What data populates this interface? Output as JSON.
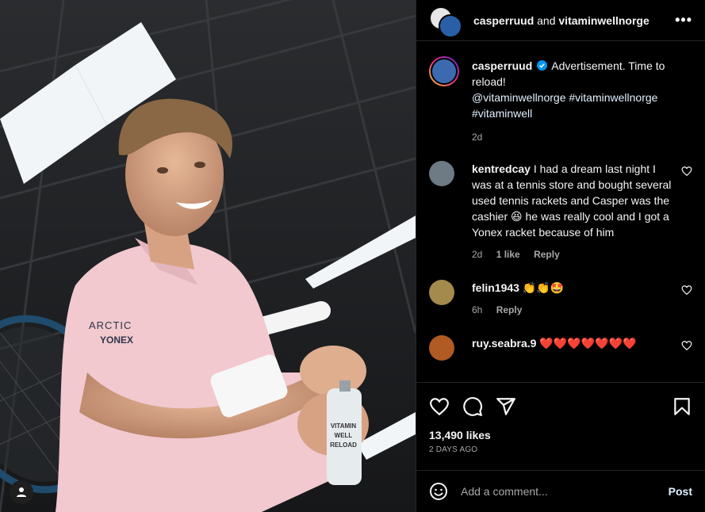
{
  "header": {
    "user1": "casperruud",
    "connector": "and",
    "user2": "vitaminwellnorge"
  },
  "caption": {
    "username": "casperruud",
    "text": "Advertisement. Time to reload!",
    "mention": "@vitaminwellnorge",
    "tags": "#vitaminwellnorge #vitaminwell",
    "age": "2d"
  },
  "comments": [
    {
      "username": "kentredcay",
      "text": "I had a dream last night I was at a tennis store and bought several used tennis rackets and Casper was the cashier 😆 he was really cool and I got a Yonex racket because of him",
      "age": "2d",
      "likes": "1 like",
      "reply": "Reply"
    },
    {
      "username": "felin1943",
      "text": "👏👏🤩",
      "age": "6h",
      "reply": "Reply"
    },
    {
      "username": "ruy.seabra.9",
      "text": "❤️❤️❤️❤️❤️❤️❤️"
    }
  ],
  "post": {
    "likes": "13,490 likes",
    "date": "2 DAYS AGO"
  },
  "add_comment": {
    "placeholder": "Add a comment...",
    "post_label": "Post"
  },
  "photo": {
    "shirt_brand_1": "ARCTIC",
    "shirt_brand_2": "YONEX",
    "bottle_label_1": "VITAMIN",
    "bottle_label_2": "WELL",
    "bottle_label_3": "RELOAD"
  }
}
